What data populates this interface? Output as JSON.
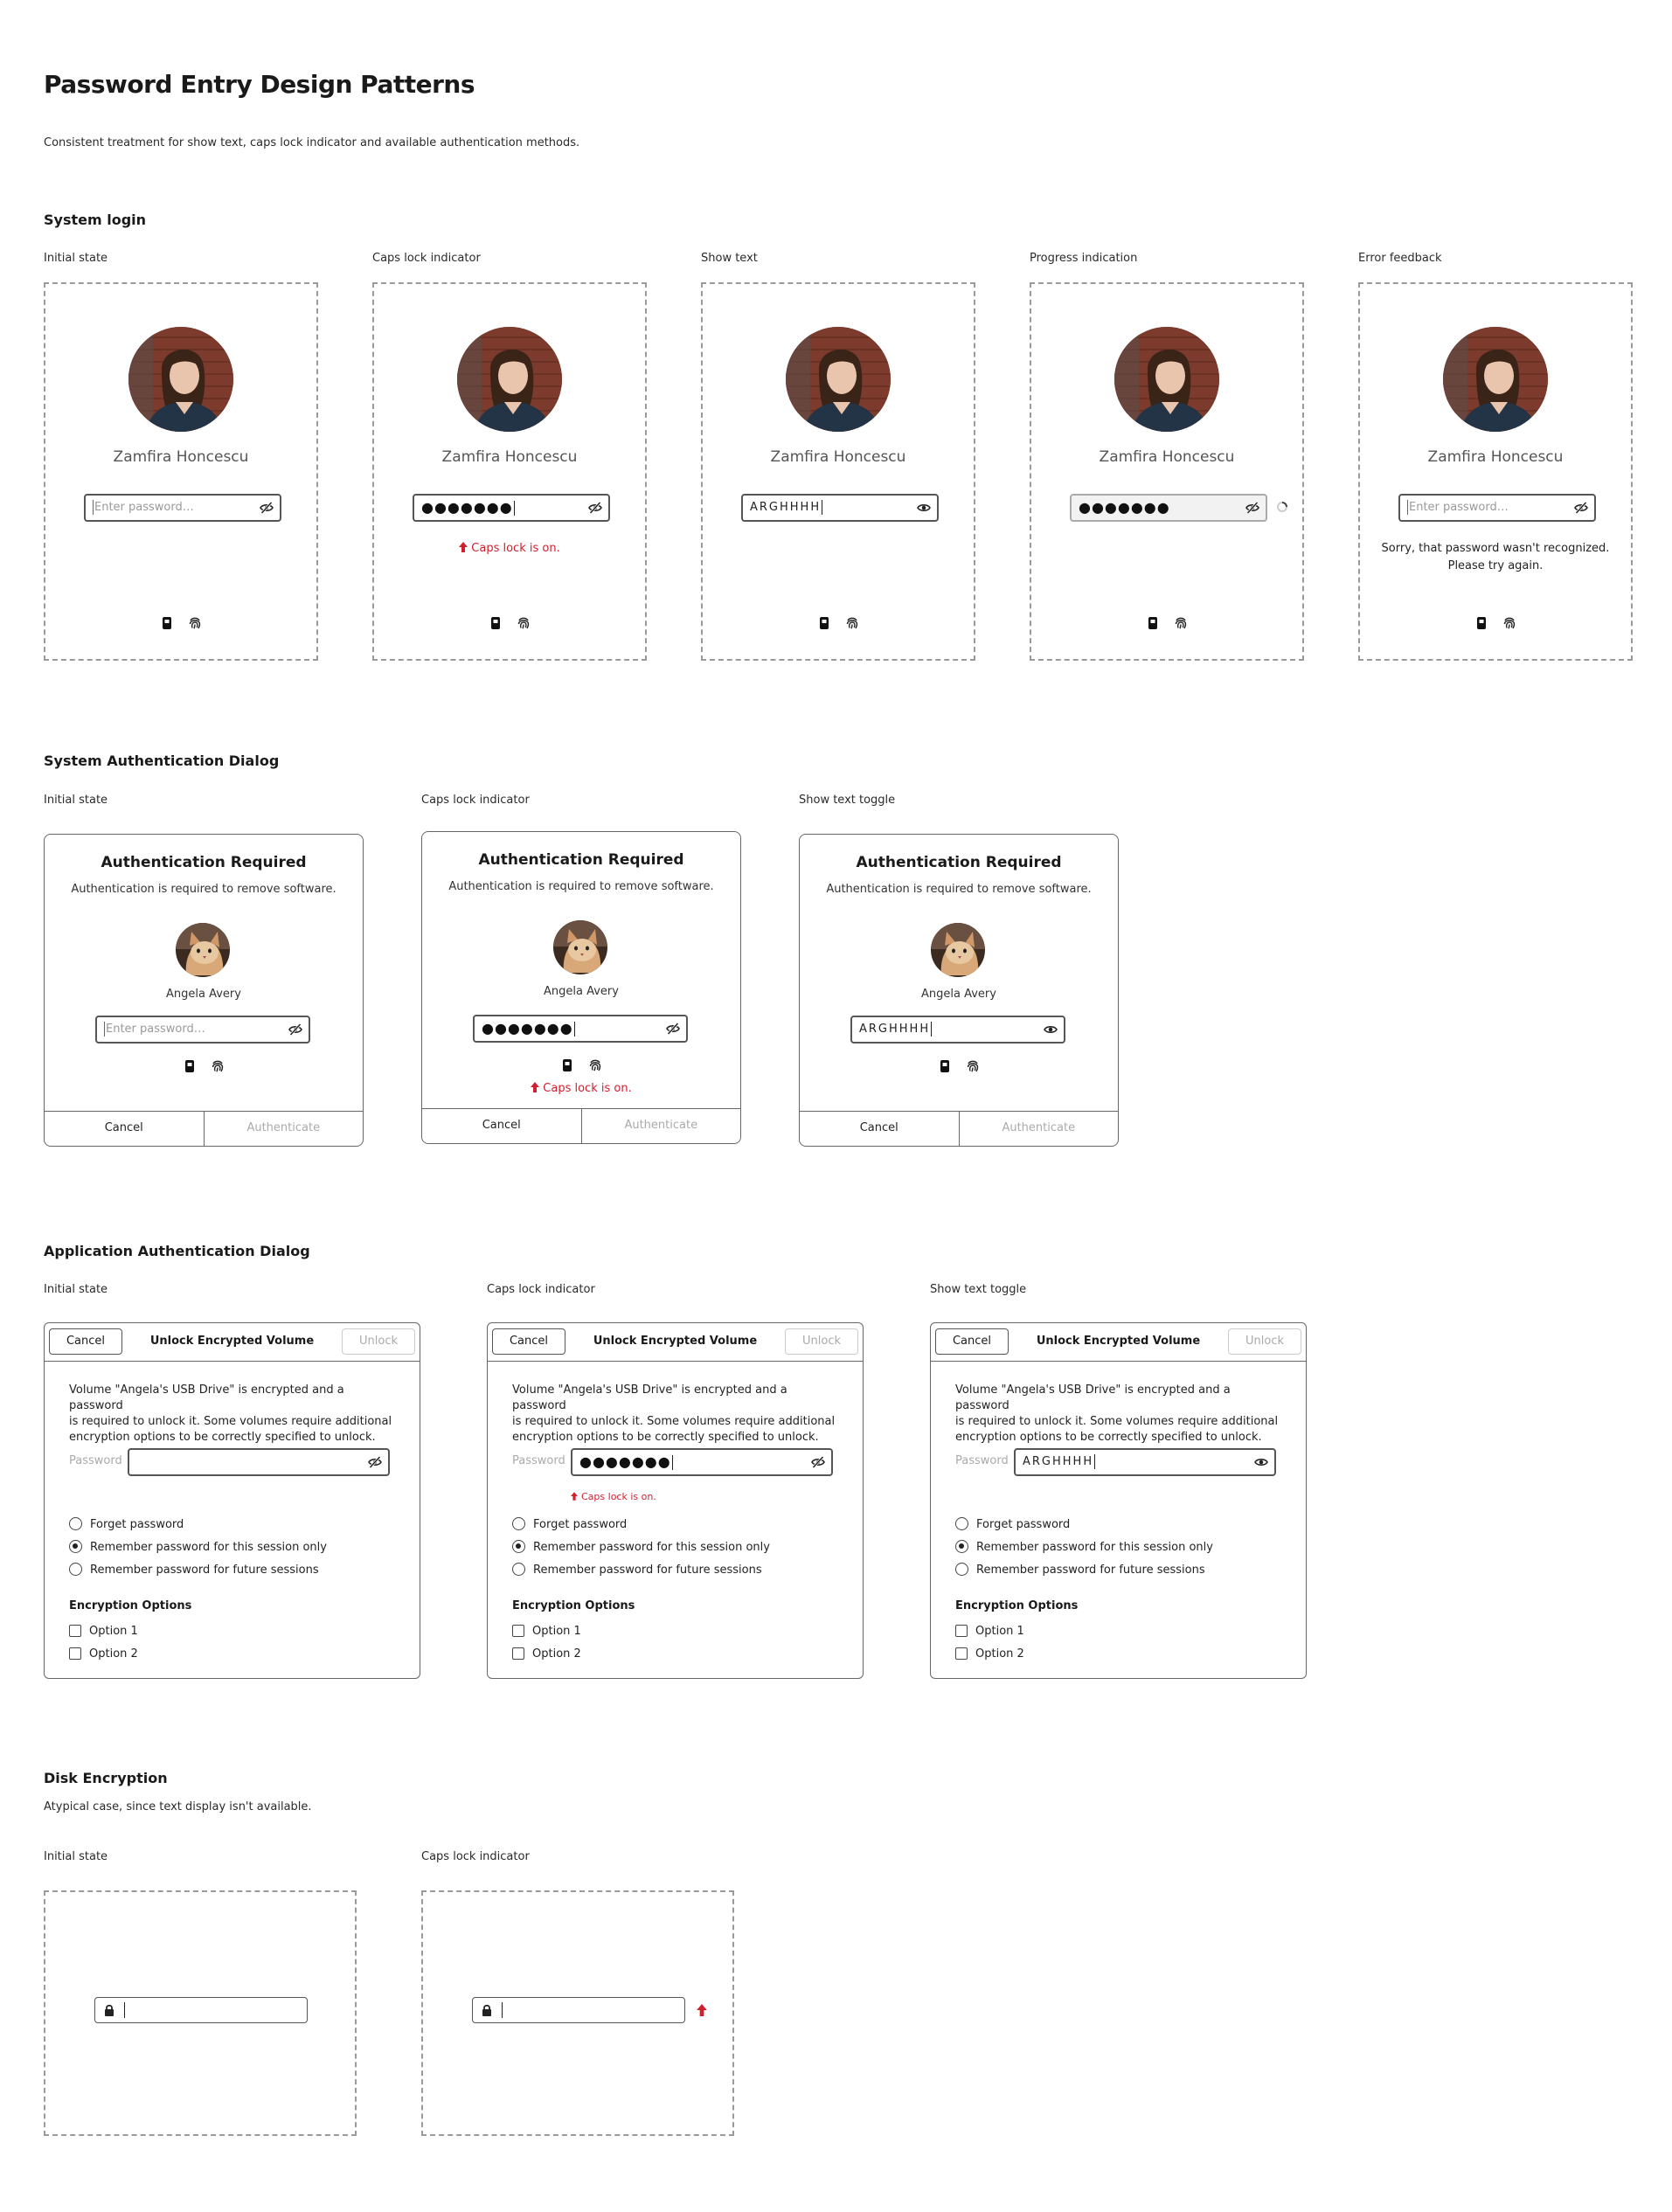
{
  "page": {
    "title": "Password Entry Design Patterns",
    "subtitle": "Consistent treatment for show text, caps lock indicator and available authentication methods."
  },
  "colors": {
    "error_red": "#d0202e",
    "border_dark": "#555555",
    "placeholder": "#9a9a9a",
    "disabled": "#aaaaaa"
  },
  "system_login": {
    "title": "System login",
    "user_name": "Zamfira Honcescu",
    "placeholder": "Enter password…",
    "masked_value": "●●●●●●●",
    "plain_value": "ARGHHHH",
    "caps_message": "Caps lock is on.",
    "error_line1": "Sorry, that password wasn't recognized.",
    "error_line2": "Please try again.",
    "states": [
      "Initial state",
      "Caps lock indicator",
      "Show text",
      "Progress indication",
      "Error feedback"
    ],
    "icons": [
      "eye-slash-icon",
      "eye-icon",
      "smartcard-icon",
      "fingerprint-icon",
      "spinner-icon",
      "caps-lock-arrow-icon"
    ]
  },
  "system_auth": {
    "title": "System Authentication Dialog",
    "states": [
      "Initial state",
      "Caps lock indicator",
      "Show text toggle"
    ],
    "dialog_title": "Authentication Required",
    "dialog_sub": "Authentication is required to remove software.",
    "user_name": "Angela Avery",
    "placeholder": "Enter password…",
    "masked_value": "●●●●●●●",
    "plain_value": "ARGHHHH",
    "caps_message": "Caps lock is on.",
    "cancel": "Cancel",
    "authenticate": "Authenticate"
  },
  "app_auth": {
    "title": "Application Authentication Dialog",
    "states": [
      "Initial state",
      "Caps lock indicator",
      "Show text toggle"
    ],
    "cancel": "Cancel",
    "dialog_title": "Unlock Encrypted Volume",
    "unlock": "Unlock",
    "body_line1": "Volume \"Angela's USB Drive\" is encrypted and a password",
    "body_line2": "is required to unlock it. Some volumes require additional",
    "body_line3": "encryption options to be correctly specified to unlock.",
    "password_label": "Password",
    "masked_value": "●●●●●●●",
    "plain_value": "ARGHHHH",
    "caps_message": "Caps lock is on.",
    "radio_forget": "Forget password",
    "radio_session": "Remember password for this session only",
    "radio_future": "Remember password for future sessions",
    "selected_radio": "Remember password for this session only",
    "enc_title": "Encryption Options",
    "option1": "Option 1",
    "option2": "Option 2"
  },
  "disk": {
    "title": "Disk Encryption",
    "description": "Atypical case, since text display isn't available.",
    "states": [
      "Initial state",
      "Caps lock indicator"
    ]
  }
}
